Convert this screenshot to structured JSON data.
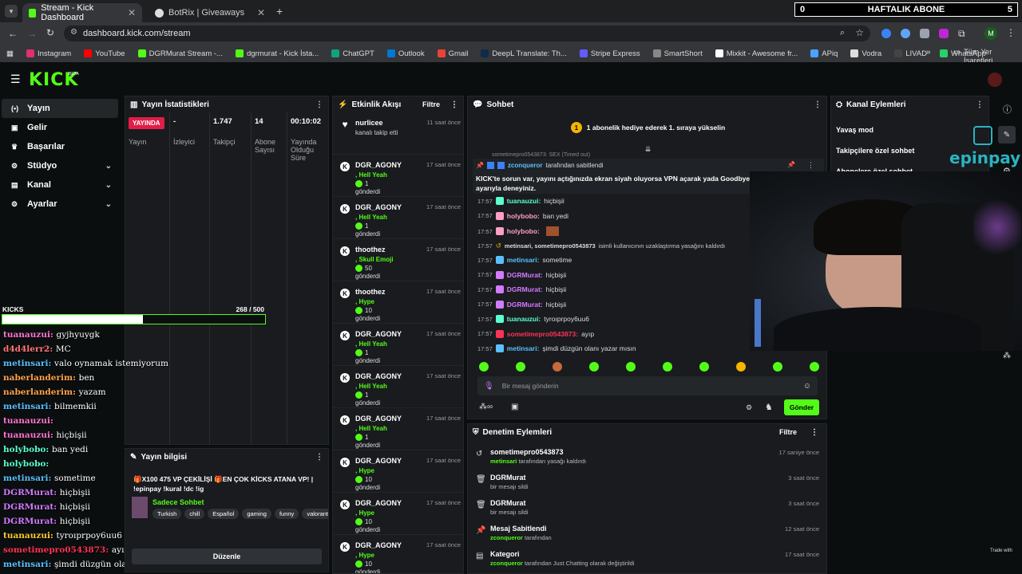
{
  "browser": {
    "tabs": [
      {
        "title": "Stream - Kick Dashboard"
      },
      {
        "title": "BotRix | Giveaways"
      }
    ],
    "url": "dashboard.kick.com/stream",
    "profile_initial": "M",
    "bookmarks": [
      "Instagram",
      "YouTube",
      "DGRMurat Stream -...",
      "dgrmurat - Kick İsta...",
      "ChatGPT",
      "Outlook",
      "Gmail",
      "DeepL Translate: Th...",
      "Stripe Express",
      "SmartShort",
      "Mixkit - Awesome fr...",
      "APiq",
      "Vodra",
      "LIVAD",
      "WhatsApp"
    ],
    "all_bookmarks": "Tüm Yer İşaretleri"
  },
  "top_overlay": {
    "left": "0",
    "title": "HAFTALIK ABONE",
    "right": "5"
  },
  "kick": {
    "logo": "KICK",
    "beta": "BETA"
  },
  "sidebar": {
    "items": [
      {
        "label": "Yayın",
        "icon": "broadcast-icon"
      },
      {
        "label": "Gelir",
        "icon": "wallet-icon"
      },
      {
        "label": "Başarılar",
        "icon": "trophy-icon"
      },
      {
        "label": "Stüdyo",
        "icon": "studio-icon"
      },
      {
        "label": "Kanal",
        "icon": "channel-icon"
      },
      {
        "label": "Ayarlar",
        "icon": "gear-icon"
      }
    ]
  },
  "stats": {
    "title": "Yayın İstatistikleri",
    "live_badge": "YAYINDA",
    "cols": [
      {
        "value": "",
        "label": "Yayın"
      },
      {
        "value": "-",
        "label": "İzleyici"
      },
      {
        "value": "1.747",
        "label": "Takipçi"
      },
      {
        "value": "14",
        "label": "Abone Sayısı"
      },
      {
        "value": "00:10:02",
        "label": "Yayında Olduğu Süre"
      }
    ]
  },
  "kicks_bar": {
    "label": "KICKS",
    "current": "268",
    "total": "/ 500",
    "progress": 0.536
  },
  "overlay_chat": [
    {
      "user": "tuanauzui:",
      "msg": "gyjhyuygk",
      "color": "#ff77d4"
    },
    {
      "user": "d4d4lerr2:",
      "msg": "MC",
      "color": "#ff7777"
    },
    {
      "user": "metinsari:",
      "msg": "valo oynamak istemiyorum",
      "color": "#5bc0ff"
    },
    {
      "user": "naberlanderim:",
      "msg": "ben",
      "color": "#ffa54a"
    },
    {
      "user": "naberlanderim:",
      "msg": "yazam",
      "color": "#ffa54a"
    },
    {
      "user": "metinsari:",
      "msg": "bilmemkii",
      "color": "#5bc0ff"
    },
    {
      "user": "tuanauzui:",
      "msg": "",
      "color": "#ff77d4"
    },
    {
      "user": "tuanauzui:",
      "msg": "hiçbişii",
      "color": "#ff77d4"
    },
    {
      "user": "holybobo:",
      "msg": "ban yedi",
      "color": "#5bffcf"
    },
    {
      "user": "holybobo:",
      "msg": "",
      "color": "#5bffcf"
    },
    {
      "user": "metinsari:",
      "msg": "sometime",
      "color": "#5bc0ff"
    },
    {
      "user": "DGRMurat:",
      "msg": "hiçbişii",
      "color": "#d27bff"
    },
    {
      "user": "DGRMurat:",
      "msg": "hiçbişii",
      "color": "#d27bff"
    },
    {
      "user": "DGRMurat:",
      "msg": "hiçbişii",
      "color": "#d27bff"
    },
    {
      "user": "tuanauzui:",
      "msg": "tyroıprpoy6uu6",
      "color": "#ffcc33"
    },
    {
      "user": "sometimepro0543873:",
      "msg": "ayıp",
      "color": "#ff3355"
    },
    {
      "user": "metinsari:",
      "msg": "şimdi düzgün olanı yazar mısın",
      "color": "#5bc0ff"
    }
  ],
  "info": {
    "title": "Yayın bilgisi",
    "stream_title": "🎁X100 475 VP ÇEKİLİŞİ 🎁EN ÇOK KİCKS ATANA VP! | !epinpay !kural !dc !ig",
    "category": "Sadece Sohbet",
    "tags": [
      "Turkish",
      "chill",
      "Español",
      "gaming",
      "funny",
      "valorant"
    ],
    "edit": "Düzenle"
  },
  "activity": {
    "title": "Etkinlik Akışı",
    "filter": "Filtre",
    "items": [
      {
        "name": "nurlicee",
        "sub": "kanalı takip etti",
        "amount": "",
        "sent": "",
        "time": "11 saat önce",
        "type": "follow"
      },
      {
        "name": "DGR_AGONY",
        "sub": ", Hell Yeah",
        "amount": "1",
        "sent": "gönderdi",
        "time": "17 saat önce",
        "type": "kick"
      },
      {
        "name": "DGR_AGONY",
        "sub": ", Hell Yeah",
        "amount": "1",
        "sent": "gönderdi",
        "time": "17 saat önce",
        "type": "kick"
      },
      {
        "name": "thoothez",
        "sub": ", Skull Emoji",
        "amount": "50",
        "sent": "gönderdi",
        "time": "17 saat önce",
        "type": "kick"
      },
      {
        "name": "thoothez",
        "sub": ", Hype",
        "amount": "10",
        "sent": "gönderdi",
        "time": "17 saat önce",
        "type": "kick"
      },
      {
        "name": "DGR_AGONY",
        "sub": ", Hell Yeah",
        "amount": "1",
        "sent": "gönderdi",
        "time": "17 saat önce",
        "type": "kick"
      },
      {
        "name": "DGR_AGONY",
        "sub": ", Hell Yeah",
        "amount": "1",
        "sent": "gönderdi",
        "time": "17 saat önce",
        "type": "kick"
      },
      {
        "name": "DGR_AGONY",
        "sub": ", Hell Yeah",
        "amount": "1",
        "sent": "gönderdi",
        "time": "17 saat önce",
        "type": "kick"
      },
      {
        "name": "DGR_AGONY",
        "sub": ", Hype",
        "amount": "10",
        "sent": "gönderdi",
        "time": "17 saat önce",
        "type": "kick"
      },
      {
        "name": "DGR_AGONY",
        "sub": ", Hype",
        "amount": "10",
        "sent": "gönderdi",
        "time": "17 saat önce",
        "type": "kick"
      },
      {
        "name": "DGR_AGONY",
        "sub": ", Hype",
        "amount": "10",
        "sent": "gönderdi",
        "time": "17 saat önce",
        "type": "kick"
      }
    ]
  },
  "chat": {
    "title": "Sohbet",
    "gift_banner": "1 abonelik hediye ederek 1. sıraya yükselin",
    "gift_count": "1",
    "top_line": "sometimepro0543873: SEX (Timed out)",
    "pinned_by": "zconqueror",
    "pinned_by_suffix": "tarafından sabitlendi",
    "pinned_msg": "KICK'te sorun var, yayını açtığınızda ekran siyah oluyorsa VPN açarak yada Goodbye ayarıyla deneyiniz.",
    "messages": [
      {
        "time": "17:57",
        "user": "tuanauzui:",
        "msg": "hiçbişii",
        "color": "#5bffcf"
      },
      {
        "time": "17:57",
        "user": "holybobo:",
        "msg": "ban yedi",
        "color": "#ff9ec7"
      },
      {
        "time": "17:57",
        "user": "holybobo:",
        "msg": "",
        "color": "#ff9ec7"
      },
      {
        "time": "17:57",
        "user": "metinsari, sometimepro0543873",
        "msg": "isimli kullanıcının uzaklaştırma yasağını kaldırdı",
        "color": "#dddddd",
        "system": true
      },
      {
        "time": "17:57",
        "user": "metinsari:",
        "msg": "sometime",
        "color": "#5bc0ff"
      },
      {
        "time": "17:57",
        "user": "DGRMurat:",
        "msg": "hiçbişii",
        "color": "#d27bff"
      },
      {
        "time": "17:57",
        "user": "DGRMurat:",
        "msg": "hiçbişii",
        "color": "#d27bff"
      },
      {
        "time": "17:57",
        "user": "DGRMurat:",
        "msg": "hiçbişii",
        "color": "#d27bff"
      },
      {
        "time": "17:57",
        "user": "tuanauzui:",
        "msg": "tyroıprpoy6uu6",
        "color": "#5bffcf"
      },
      {
        "time": "17:57",
        "user": "sometimepro0543873:",
        "msg": "ayıp",
        "color": "#ff3355"
      },
      {
        "time": "17:57",
        "user": "metinsari:",
        "msg": "şimdi düzgün olanı yazar mısın",
        "color": "#5bc0ff"
      }
    ],
    "placeholder": "Bir mesaj gönderin",
    "send": "Gönder"
  },
  "moderation": {
    "title": "Denetim Eylemleri",
    "filter": "Filtre",
    "items": [
      {
        "name": "sometimepro0543873",
        "by": "metinsari",
        "suffix": "tarafından yasağı kaldırdı",
        "time": "17 saniye önce",
        "icon": "undo-icon"
      },
      {
        "name": "DGRMurat",
        "by": "",
        "suffix": "bir mesajı sildi",
        "time": "3 saat önce",
        "icon": "trash-icon"
      },
      {
        "name": "DGRMurat",
        "by": "",
        "suffix": "bir mesajı sildi",
        "time": "3 saat önce",
        "icon": "trash-icon"
      },
      {
        "name": "Mesaj Sabitlendi",
        "by": "zconqueror",
        "suffix": "tarafından",
        "time": "12 saat önce",
        "icon": "pin-icon"
      },
      {
        "name": "Kategori",
        "by": "zconqueror",
        "suffix": "tarafından Just Chatting olarak değiştirildi",
        "time": "17 saat önce",
        "icon": "category-icon"
      }
    ]
  },
  "channel_actions": {
    "title": "Kanal Eylemleri",
    "items": [
      "Yavaş mod",
      "Takipçilere özel sohbet",
      "Abonelere özel sohbet"
    ]
  },
  "epinpay": "epinpay",
  "trade_with": "Trade with",
  "colors": {
    "kick_green": "#53fc18",
    "panel": "#191b1f",
    "bg": "#0b0e0f"
  }
}
